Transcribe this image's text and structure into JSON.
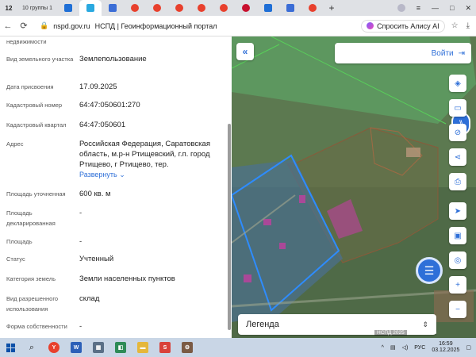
{
  "browser": {
    "tab_count": "12",
    "tab_group_label": "10 группы 1",
    "url_domain": "nspd.gov.ru",
    "page_title": "НСПД | Геоинформационный портал",
    "alice_label": "Спросить Алису AI"
  },
  "panel": {
    "top_fragment": "недвижимости",
    "rows": [
      {
        "label": "Вид земельного участка",
        "value": "Землепользование"
      },
      {
        "label": "Дата присвоения",
        "value": "17.09.2025"
      },
      {
        "label": "Кадастровый номер",
        "value": "64:47:050601:270"
      },
      {
        "label": "Кадастровый квартал",
        "value": "64:47:050601"
      },
      {
        "label": "Адрес",
        "value": "Российская Федерация, Саратовская область, м.р-н Ртищевский, г.п. город Ртищево, г Ртищево, тер."
      },
      {
        "label": "Площадь уточненная",
        "value": "600 кв. м"
      },
      {
        "label": "Площадь декларированная",
        "value": "-"
      },
      {
        "label": "Площадь",
        "value": "-"
      },
      {
        "label": "Статус",
        "value": "Учтенный"
      },
      {
        "label": "Категория земель",
        "value": "Земли населенных пунктов"
      },
      {
        "label": "Вид разрешенного использования",
        "value": "склад"
      },
      {
        "label": "Форма собственности",
        "value": "-"
      }
    ],
    "expand_label": "Развернуть"
  },
  "map": {
    "login_label": "Войти",
    "legend_label": "Легенда",
    "attribution": "НСПД 2025",
    "scale": "20 м"
  },
  "taskbar": {
    "lang": "РУС",
    "time": "16:59",
    "date": "03.12.2025"
  }
}
